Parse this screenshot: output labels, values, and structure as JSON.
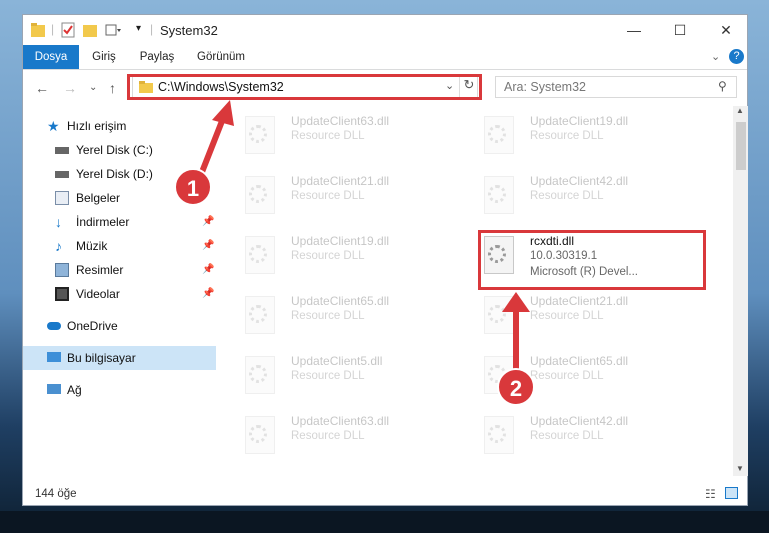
{
  "window": {
    "title": "System32",
    "controls": {
      "minimize": "—",
      "maximize": "☐",
      "close": "✕"
    }
  },
  "ribbon": {
    "tabs": [
      "Dosya",
      "Giriş",
      "Paylaş",
      "Görünüm"
    ],
    "active_tab": "Dosya"
  },
  "address": {
    "path": "C:\\Windows\\System32",
    "search_placeholder": "Ara: System32"
  },
  "sidebar": {
    "items": [
      {
        "label": "Hızlı erişim",
        "icon": "star-icon"
      },
      {
        "label": "Yerel Disk (C:)",
        "icon": "drive-icon"
      },
      {
        "label": "Yerel Disk (D:)",
        "icon": "drive-icon"
      },
      {
        "label": "Belgeler",
        "icon": "documents-icon"
      },
      {
        "label": "İndirmeler",
        "icon": "download-icon"
      },
      {
        "label": "Müzik",
        "icon": "music-icon"
      },
      {
        "label": "Resimler",
        "icon": "pictures-icon"
      },
      {
        "label": "Videolar",
        "icon": "videos-icon"
      },
      {
        "label": "OneDrive",
        "icon": "cloud-icon"
      },
      {
        "label": "Bu bilgisayar",
        "icon": "computer-icon"
      },
      {
        "label": "Ağ",
        "icon": "network-icon"
      }
    ]
  },
  "files": [
    {
      "name": "UpdateClient63.dll",
      "desc": "Resource DLL"
    },
    {
      "name": "UpdateClient19.dll",
      "desc": "Resource DLL"
    },
    {
      "name": "UpdateClient21.dll",
      "desc": "Resource DLL"
    },
    {
      "name": "UpdateClient42.dll",
      "desc": "Resource DLL"
    },
    {
      "name": "UpdateClient19.dll",
      "desc": "Resource DLL"
    },
    {
      "name": "rcxdti.dll",
      "desc": "10.0.30319.1",
      "desc2": "Microsoft (R) Devel..."
    },
    {
      "name": "UpdateClient65.dll",
      "desc": "Resource DLL"
    },
    {
      "name": "UpdateClient21.dll",
      "desc": "Resource DLL"
    },
    {
      "name": "UpdateClient5.dll",
      "desc": "Resource DLL"
    },
    {
      "name": "UpdateClient65.dll",
      "desc": "Resource DLL"
    },
    {
      "name": "UpdateClient63.dll",
      "desc": "Resource DLL"
    },
    {
      "name": "UpdateClient42.dll",
      "desc": "Resource DLL"
    }
  ],
  "status": {
    "count": "144 öğe"
  },
  "annotations": {
    "badge1": "1",
    "badge2": "2"
  },
  "colors": {
    "accent": "#1979ca",
    "annotation": "#d9383b",
    "selected": "#cce4f7"
  }
}
